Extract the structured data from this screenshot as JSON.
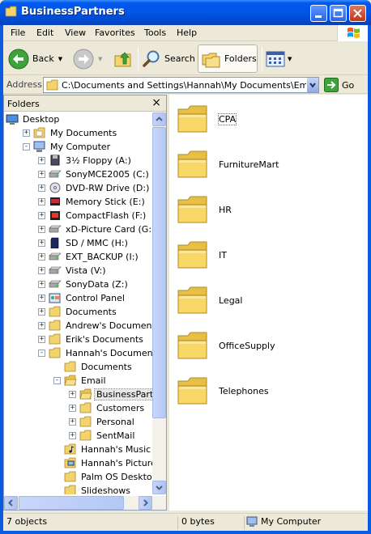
{
  "window": {
    "title": "BusinessPartners"
  },
  "menu": [
    "File",
    "Edit",
    "View",
    "Favorites",
    "Tools",
    "Help"
  ],
  "toolbar": {
    "back": "Back",
    "search": "Search",
    "folders": "Folders"
  },
  "address": {
    "label": "Address",
    "path": "C:\\Documents and Settings\\Hannah\\My Documents\\Email\\BusinessPartners",
    "go": "Go"
  },
  "folders_pane": {
    "title": "Folders",
    "tree": [
      {
        "label": "Desktop",
        "icon": "desktop-icon",
        "expander": ""
      },
      {
        "label": "My Documents",
        "icon": "my-documents-icon",
        "expander": "+"
      },
      {
        "label": "My Computer",
        "icon": "my-computer-icon",
        "expander": "-"
      },
      {
        "label": "3½ Floppy (A:)",
        "icon": "floppy-icon",
        "expander": "+"
      },
      {
        "label": "SonyMCE2005 (C:)",
        "icon": "hard-drive-icon",
        "expander": "+"
      },
      {
        "label": "DVD-RW Drive (D:)",
        "icon": "dvd-drive-icon",
        "expander": "+"
      },
      {
        "label": "Memory Stick (E:)",
        "icon": "memory-stick-icon",
        "expander": "+"
      },
      {
        "label": "CompactFlash (F:)",
        "icon": "compactflash-icon",
        "expander": "+"
      },
      {
        "label": "xD-Picture Card (G:)",
        "icon": "removable-drive-icon",
        "expander": "+"
      },
      {
        "label": "SD / MMC (H:)",
        "icon": "sd-card-icon",
        "expander": "+"
      },
      {
        "label": "EXT_BACKUP (I:)",
        "icon": "hard-drive-icon",
        "expander": "+"
      },
      {
        "label": "Vista (V:)",
        "icon": "hard-drive-icon",
        "expander": "+"
      },
      {
        "label": "SonyData (Z:)",
        "icon": "hard-drive-icon",
        "expander": "+"
      },
      {
        "label": "Control Panel",
        "icon": "control-panel-icon",
        "expander": "+"
      },
      {
        "label": "Documents",
        "icon": "folder-icon",
        "expander": "+"
      },
      {
        "label": "Andrew's Documents",
        "icon": "folder-icon",
        "expander": "+"
      },
      {
        "label": "Erik's Documents",
        "icon": "folder-icon",
        "expander": "+"
      },
      {
        "label": "Hannah's Documents",
        "icon": "folder-icon",
        "expander": "-"
      },
      {
        "label": "Documents",
        "icon": "folder-icon",
        "expander": ""
      },
      {
        "label": "Email",
        "icon": "folder-open-icon",
        "expander": "-"
      },
      {
        "label": "BusinessPartners",
        "icon": "folder-open-icon",
        "expander": "+",
        "selected": true
      },
      {
        "label": "Customers",
        "icon": "folder-icon",
        "expander": "+"
      },
      {
        "label": "Personal",
        "icon": "folder-icon",
        "expander": "+"
      },
      {
        "label": "SentMail",
        "icon": "folder-icon",
        "expander": "+"
      },
      {
        "label": "Hannah's Music",
        "icon": "music-folder-icon",
        "expander": ""
      },
      {
        "label": "Hannah's Pictures",
        "icon": "pictures-folder-icon",
        "expander": ""
      },
      {
        "label": "Palm OS Desktop",
        "icon": "folder-icon",
        "expander": ""
      },
      {
        "label": "Slideshows",
        "icon": "folder-icon",
        "expander": ""
      }
    ]
  },
  "content": {
    "items": [
      {
        "name": "CPA",
        "focused": true
      },
      {
        "name": "FurnitureMart"
      },
      {
        "name": "HR"
      },
      {
        "name": "IT"
      },
      {
        "name": "Legal"
      },
      {
        "name": "OfficeSupply"
      },
      {
        "name": "Telephones"
      }
    ]
  },
  "status": {
    "count": "7 objects",
    "size": "0 bytes",
    "location": "My Computer"
  }
}
